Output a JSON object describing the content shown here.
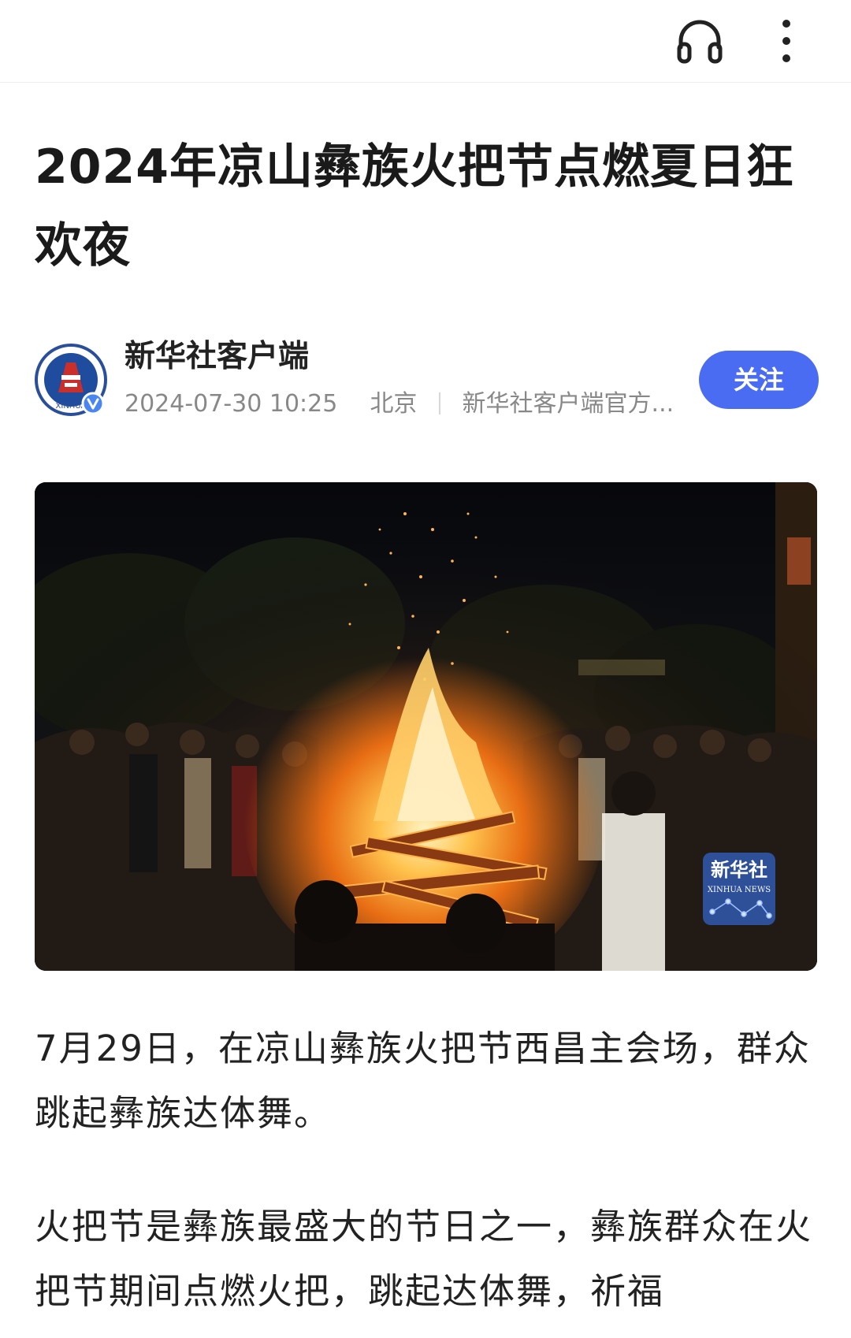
{
  "toolbar": {
    "listen_icon": "headphones-icon",
    "more_icon": "more-vertical-icon"
  },
  "article": {
    "title": "2024年凉山彝族火把节点燃夏日狂欢夜",
    "paragraphs": [
      "7月29日，在凉山彝族火把节西昌主会场，群众跳起彝族达体舞。",
      "火把节是彝族最盛大的节日之一，彝族群众在火把节期间点燃火把，跳起达体舞，祈福"
    ]
  },
  "author": {
    "name": "新华社客户端",
    "datetime": "2024-07-30 10:25",
    "location": "北京",
    "source": "新华社客户端官方...",
    "follow_label": "关注",
    "avatar_text": "XINHUA",
    "verified_icon": "verified-v-icon"
  },
  "photo": {
    "watermark_cn": "新华社",
    "watermark_en": "XINHUA NEWS"
  },
  "colors": {
    "accent": "#4a6cf2",
    "title": "#1a1a1a",
    "meta": "#888888"
  }
}
